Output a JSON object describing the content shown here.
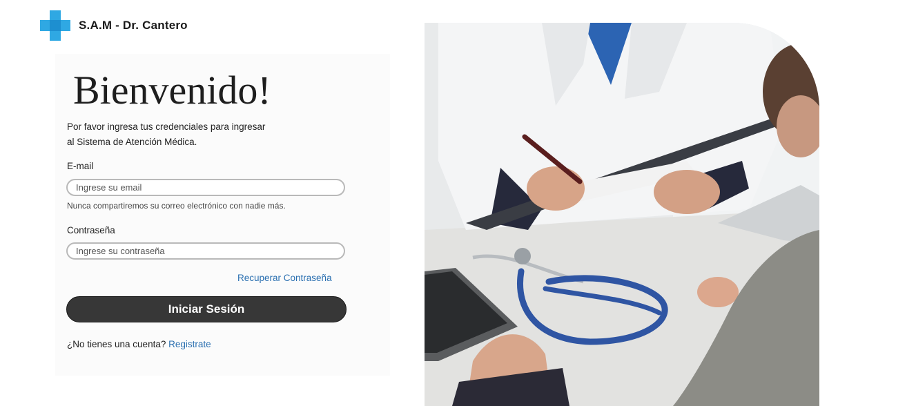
{
  "brand": {
    "name": "S.A.M - Dr. Cantero",
    "icon": "medical-cross-icon",
    "icon_color": "#2fa8e3"
  },
  "login": {
    "title": "Bienvenido!",
    "intro_line1": "Por favor ingresa tus credenciales para ingresar",
    "intro_line2": "al Sistema de Atención Médica.",
    "email_label": "E-mail",
    "email_placeholder": "Ingrese su email",
    "email_value": "",
    "email_help": "Nunca compartiremos su correo electrónico con nadie más.",
    "password_label": "Contraseña",
    "password_placeholder": "Ingrese su contraseña",
    "password_value": "",
    "recover_link": "Recuperar Contraseña",
    "submit_label": "Iniciar Sesión",
    "signup_prompt": "¿No tienes una cuenta?",
    "signup_link": "Registrate"
  },
  "colors": {
    "button_bg": "#373737",
    "link": "#2a6fb0",
    "accent": "#2fa8e3"
  }
}
